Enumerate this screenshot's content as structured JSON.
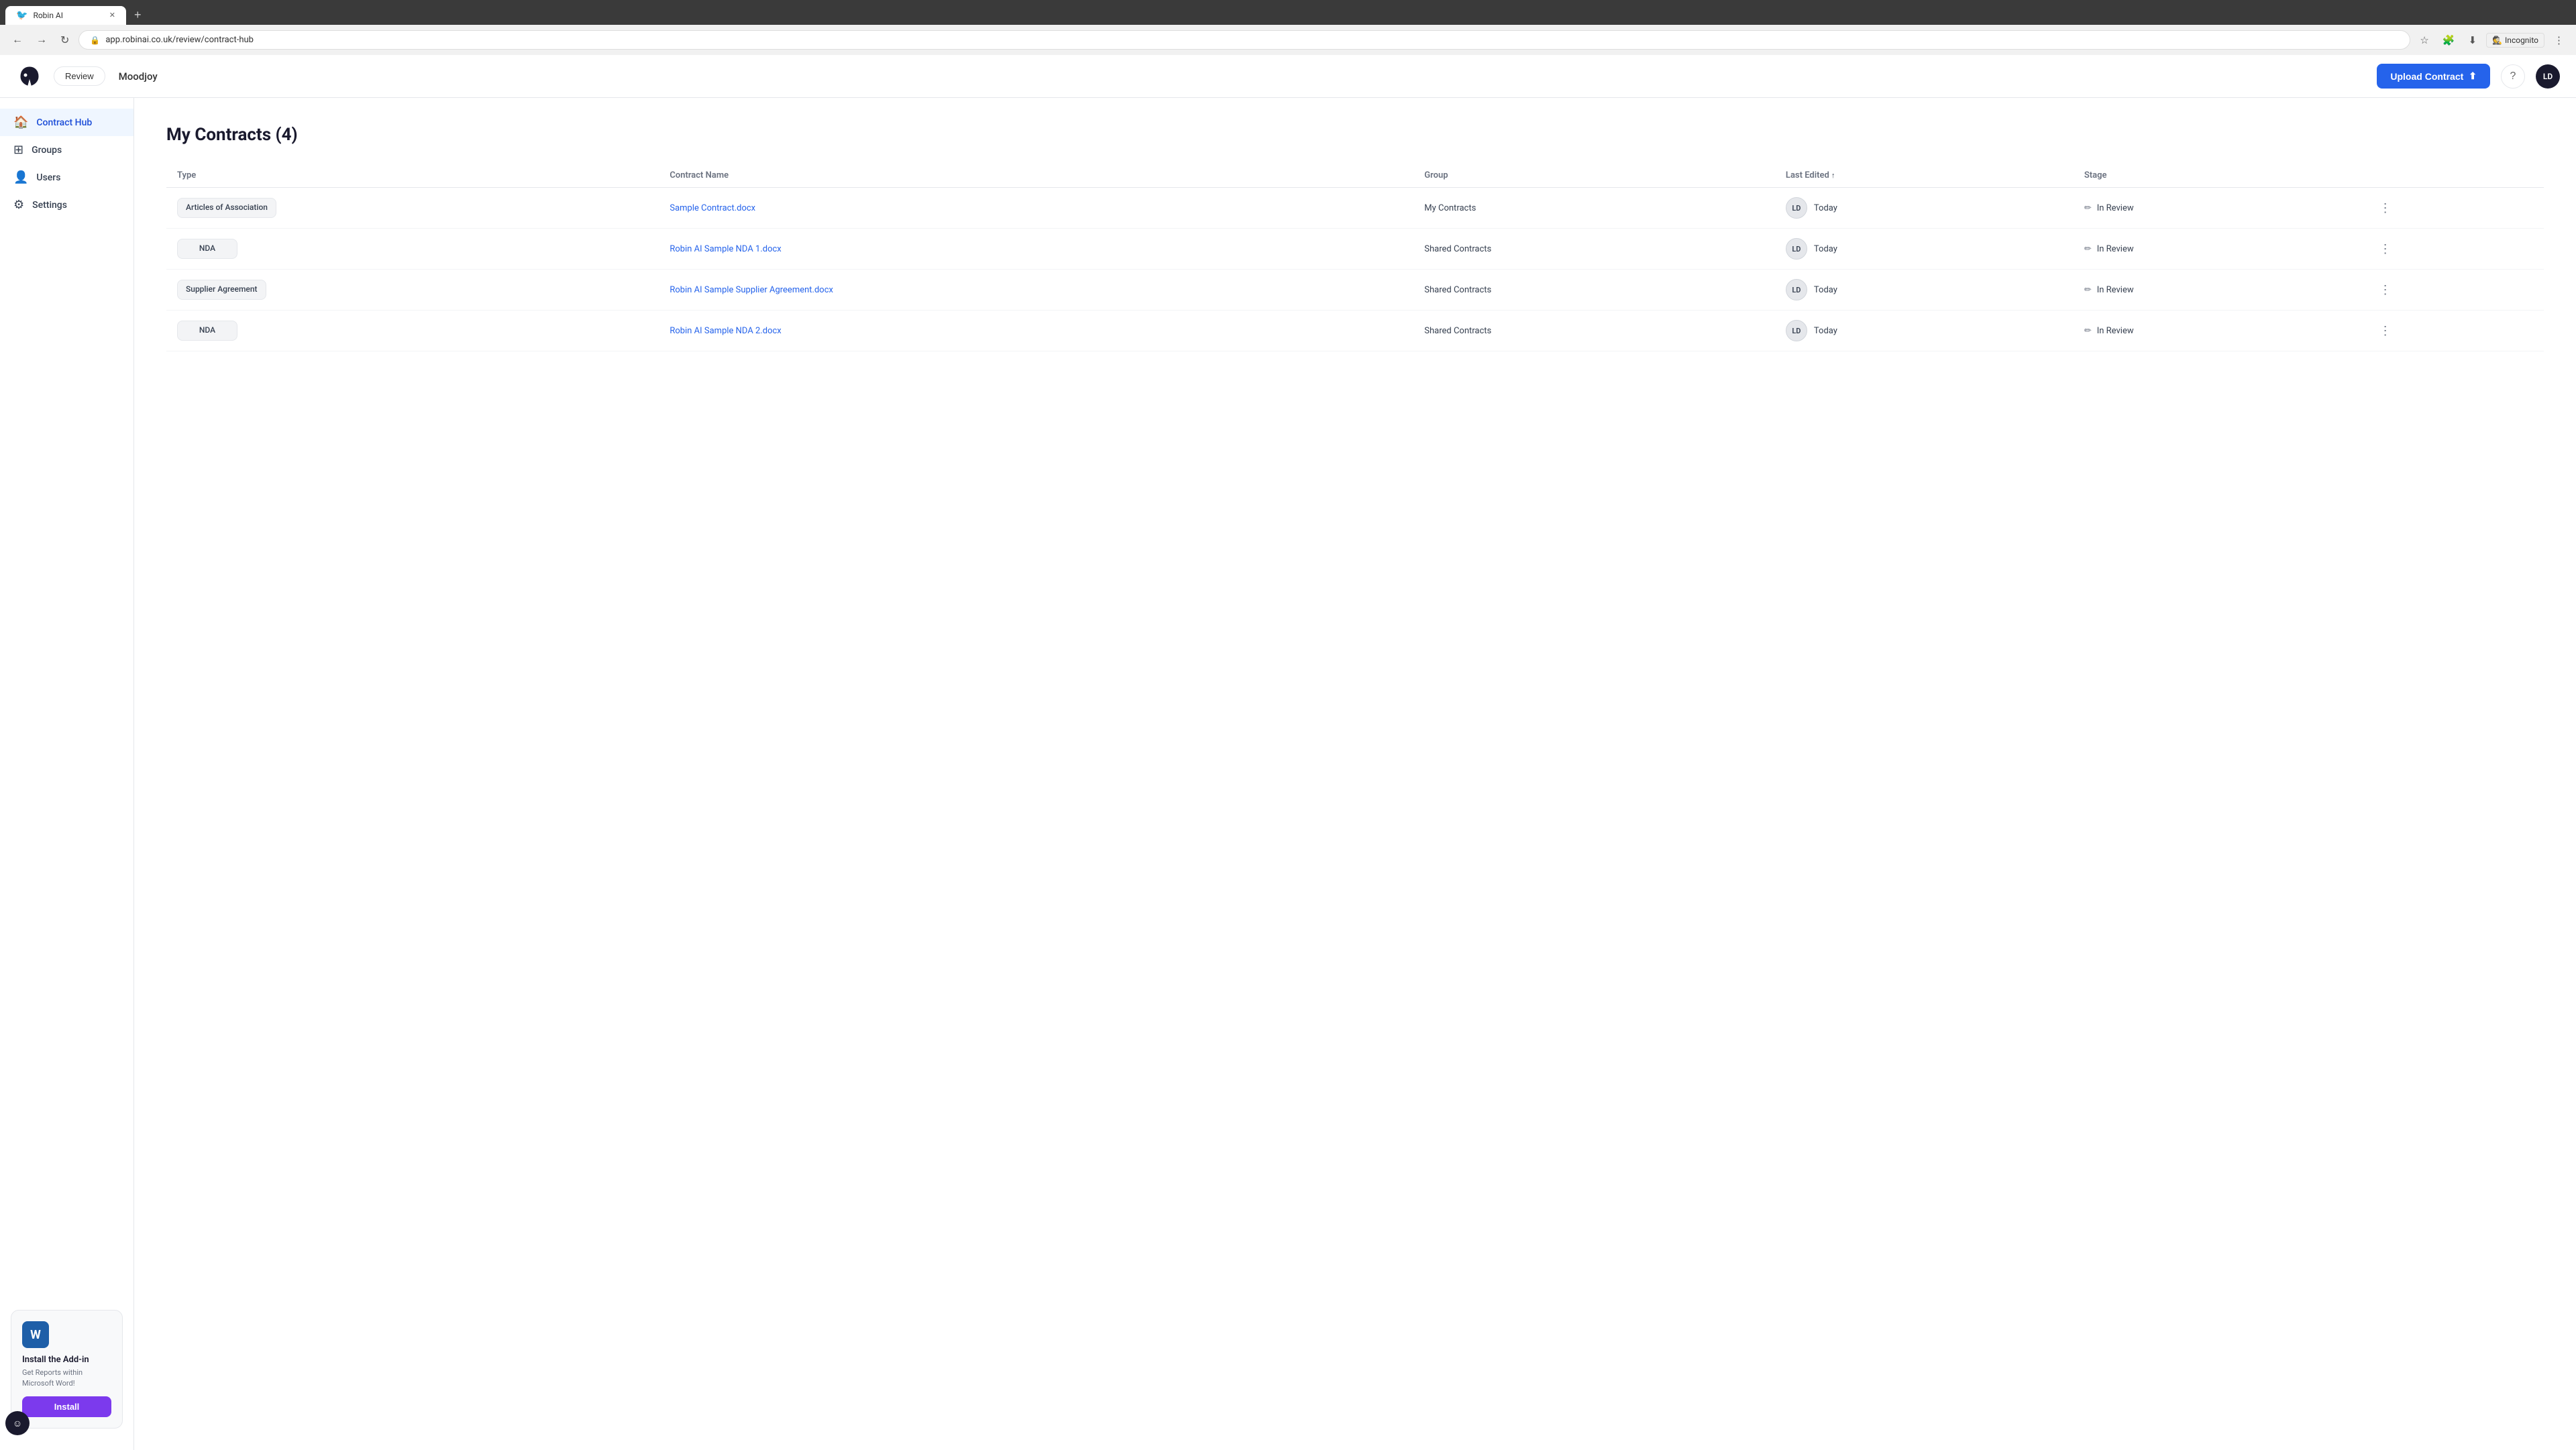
{
  "browser": {
    "tab_label": "Robin AI",
    "tab_icon": "🐦",
    "new_tab_icon": "+",
    "address": "app.robinai.co.uk/review/contract-hub",
    "incognito_label": "Incognito",
    "nav": {
      "back": "←",
      "forward": "→",
      "refresh": "↻"
    }
  },
  "header": {
    "review_button": "Review",
    "org_name": "Moodjoy",
    "upload_button": "Upload Contract",
    "upload_icon": "↑",
    "help_icon": "?",
    "user_initials": "LD"
  },
  "sidebar": {
    "items": [
      {
        "id": "contract-hub",
        "label": "Contract Hub",
        "icon": "🏠",
        "active": true
      },
      {
        "id": "groups",
        "label": "Groups",
        "icon": "⊞",
        "active": false
      },
      {
        "id": "users",
        "label": "Users",
        "icon": "👤",
        "active": false
      },
      {
        "id": "settings",
        "label": "Settings",
        "icon": "⚙",
        "active": false
      }
    ],
    "addin": {
      "word_letter": "W",
      "title": "Install the Add-in",
      "description": "Get Reports within Microsoft Word!",
      "install_button": "Install"
    }
  },
  "main": {
    "page_title": "My Contracts (4)",
    "table": {
      "columns": [
        {
          "id": "type",
          "label": "Type"
        },
        {
          "id": "contract_name",
          "label": "Contract Name"
        },
        {
          "id": "group",
          "label": "Group"
        },
        {
          "id": "last_edited",
          "label": "Last Edited",
          "sortable": true,
          "sort_active": true
        },
        {
          "id": "stage",
          "label": "Stage"
        }
      ],
      "rows": [
        {
          "type": "Articles of Association",
          "contract_name": "Sample Contract.docx",
          "group": "My Contracts",
          "avatar": "LD",
          "last_edited": "Today",
          "stage": "In Review"
        },
        {
          "type": "NDA",
          "contract_name": "Robin AI Sample NDA 1.docx",
          "group": "Shared Contracts",
          "avatar": "LD",
          "last_edited": "Today",
          "stage": "In Review"
        },
        {
          "type": "Supplier Agreement",
          "contract_name": "Robin AI Sample Supplier Agreement.docx",
          "group": "Shared Contracts",
          "avatar": "LD",
          "last_edited": "Today",
          "stage": "In Review"
        },
        {
          "type": "NDA",
          "contract_name": "Robin AI Sample NDA 2.docx",
          "group": "Shared Contracts",
          "avatar": "LD",
          "last_edited": "Today",
          "stage": "In Review"
        }
      ]
    }
  },
  "feedback_icon": "☺"
}
